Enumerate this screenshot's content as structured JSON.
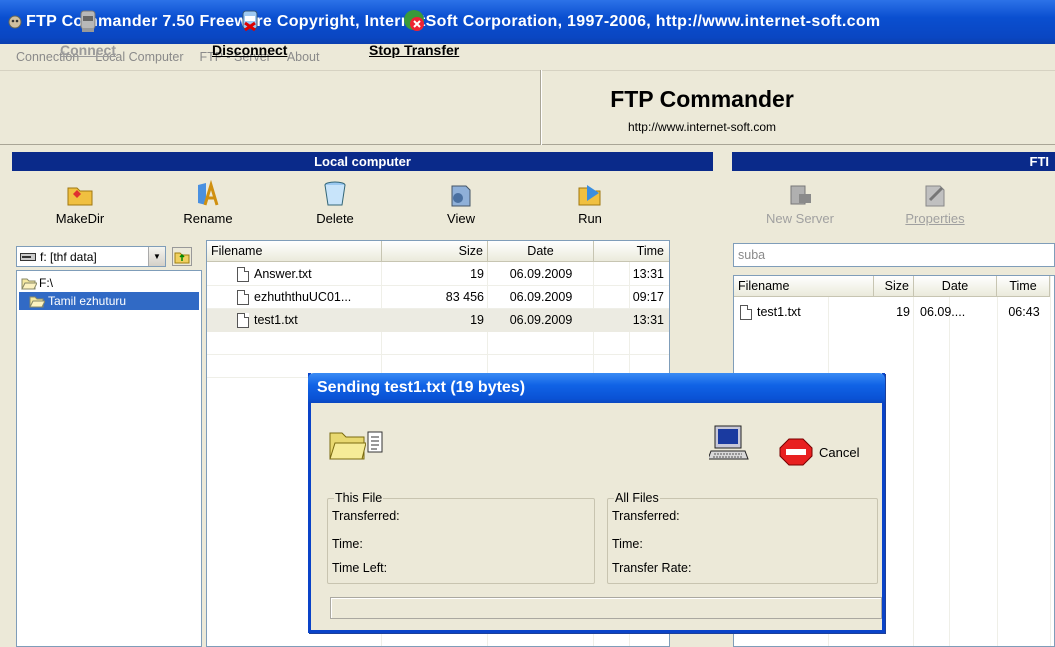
{
  "window": {
    "title": "FTP Commander 7.50  Freeware  Copyright,  InternetSoft Corporation, 1997-2006,  http://www.internet-soft.com"
  },
  "menu": [
    "Connection",
    "Local Computer",
    "FTP - Server",
    "About"
  ],
  "toolbar": {
    "connect": "Connect",
    "disconnect": "Disconnect",
    "stop_transfer": "Stop Transfer"
  },
  "brand": {
    "title": "FTP Commander",
    "url": "http://www.internet-soft.com"
  },
  "local": {
    "header": "Local computer",
    "buttons": {
      "makedir": "MakeDir",
      "rename": "Rename",
      "delete": "Delete",
      "view": "View",
      "run": "Run"
    },
    "drive": "f: [thf data]",
    "tree": [
      "F:\\",
      "Tamil ezhuturu"
    ],
    "columns": {
      "filename": "Filename",
      "size": "Size",
      "date": "Date",
      "time": "Time"
    },
    "files": [
      {
        "name": "Answer.txt",
        "size": "19",
        "date": "06.09.2009",
        "time": "13:31"
      },
      {
        "name": "ezhuththuUC01...",
        "size": "83 456",
        "date": "06.09.2009",
        "time": "09:17"
      },
      {
        "name": "test1.txt",
        "size": "19",
        "date": "06.09.2009",
        "time": "13:31"
      }
    ]
  },
  "server": {
    "header": "FTI",
    "buttons": {
      "new_server": "New Server",
      "properties": "Properties"
    },
    "combo": "suba",
    "columns": {
      "filename": "Filename",
      "size": "Size",
      "date": "Date",
      "time": "Time"
    },
    "files": [
      {
        "name": "test1.txt",
        "size": "19",
        "date": "06.09....",
        "time": "06:43"
      }
    ]
  },
  "dialog": {
    "title": "Sending test1.txt (19 bytes)",
    "cancel": "Cancel",
    "this_file": {
      "legend": "This File",
      "transferred": "Transferred:",
      "time": "Time:",
      "time_left": "Time Left:"
    },
    "all_files": {
      "legend": "All Files",
      "transferred": "Transferred:",
      "time": "Time:",
      "transfer_rate": "Transfer Rate:"
    },
    "progress": 0
  },
  "colors": {
    "title_blue": "#0a4fd0",
    "panel_header": "#0a2a8a",
    "face": "#ece9d8"
  }
}
